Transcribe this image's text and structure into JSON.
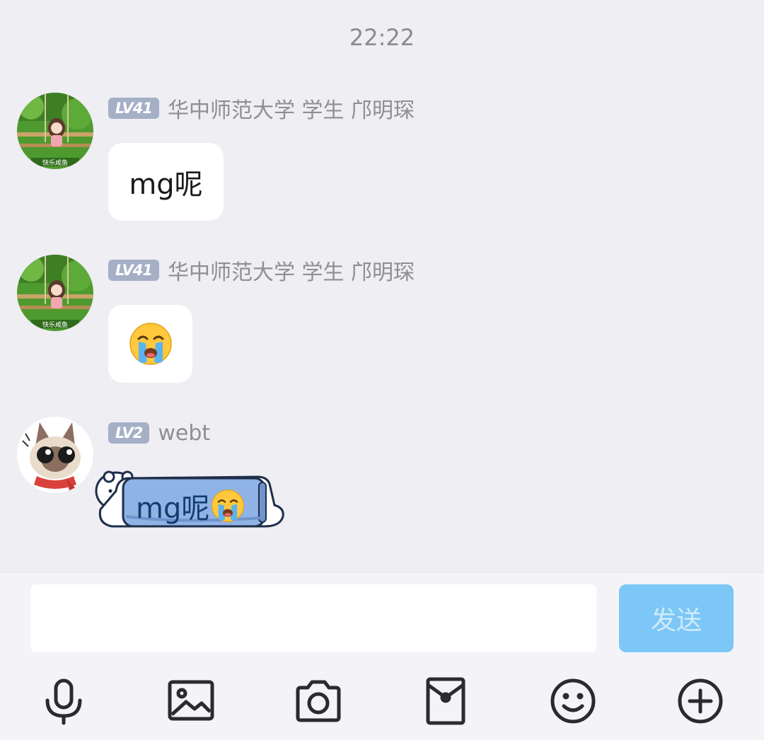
{
  "timestamp": "22:22",
  "messages": [
    {
      "level": "LV41",
      "sender": "华中师范大学 学生 邝明琛",
      "text": "mg呢",
      "avatar_icon": "anime-girl-swing-avatar-icon"
    },
    {
      "level": "LV41",
      "sender": "华中师范大学 学生 邝明琛",
      "emoji": "loudly-crying-face-emoji",
      "avatar_icon": "anime-girl-swing-avatar-icon"
    },
    {
      "level": "LV2",
      "sender": "webt",
      "sticker_text": "mg呢",
      "sticker_icon": "bear-holding-sign-sticker",
      "avatar_icon": "siamese-cat-avatar-icon"
    }
  ],
  "input": {
    "value": "",
    "send_label": "发送"
  },
  "toolbar": [
    {
      "icon": "microphone-icon"
    },
    {
      "icon": "image-icon"
    },
    {
      "icon": "camera-icon"
    },
    {
      "icon": "red-packet-icon"
    },
    {
      "icon": "emoji-icon"
    },
    {
      "icon": "plus-icon"
    }
  ],
  "colors": {
    "background": "#EEEEF3",
    "level_badge": "#A5AFC6",
    "send_button": "#7CC7F6",
    "icon": "#2B2B2E"
  }
}
